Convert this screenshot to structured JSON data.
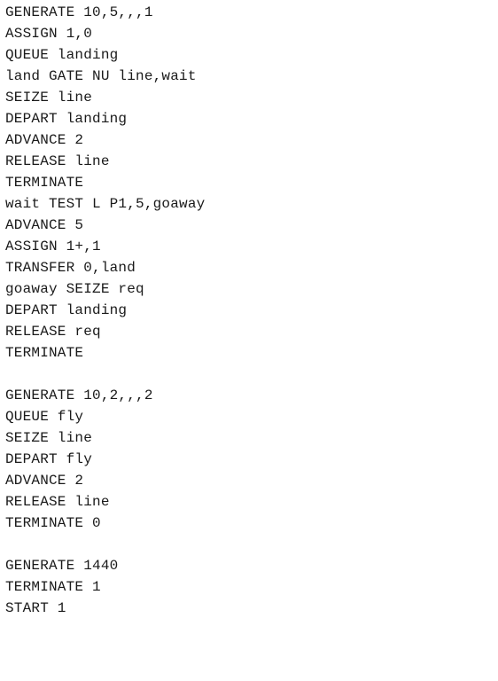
{
  "document": {
    "lines": [
      "GENERATE 10,5,,,1",
      "ASSIGN 1,0",
      "QUEUE landing",
      "land GATE NU line,wait",
      "SEIZE line",
      "DEPART landing",
      "ADVANCE 2",
      "RELEASE line",
      "TERMINATE",
      "wait TEST L P1,5,goaway",
      "ADVANCE 5",
      "ASSIGN 1+,1",
      "TRANSFER 0,land",
      "goaway SEIZE req",
      "DEPART landing",
      "RELEASE req",
      "TERMINATE",
      "",
      "GENERATE 10,2,,,2",
      "QUEUE fly",
      "SEIZE line",
      "DEPART fly",
      "ADVANCE 2",
      "RELEASE line",
      "TERMINATE 0",
      "",
      "GENERATE 1440",
      "TERMINATE 1",
      "START 1"
    ]
  },
  "colors": {
    "background": "#ffffff",
    "text": "#1a1a1a"
  }
}
